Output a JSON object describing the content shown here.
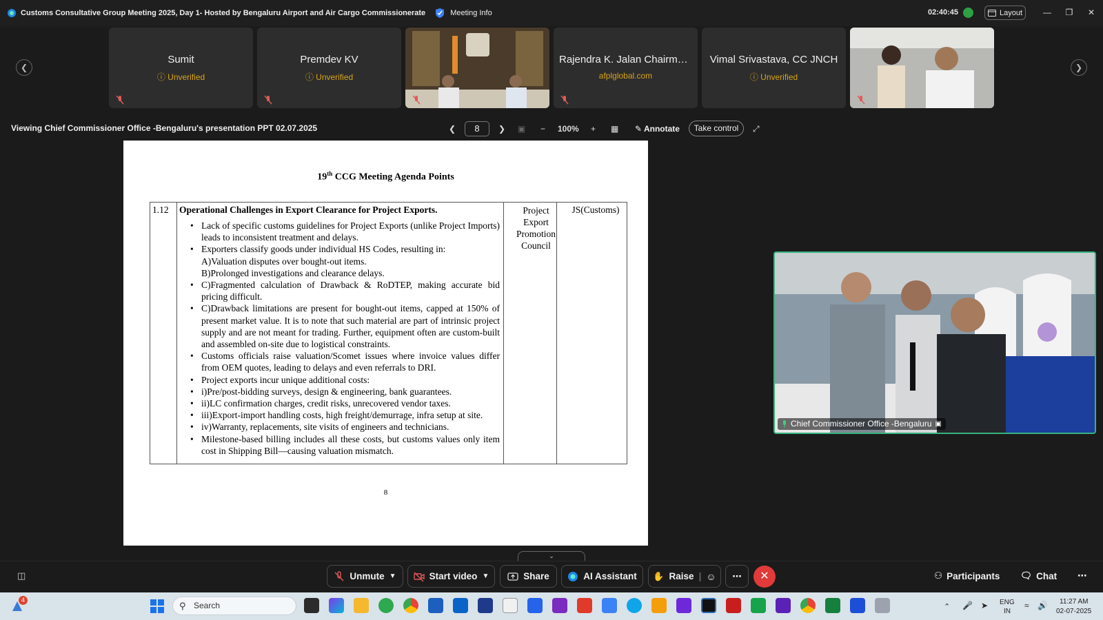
{
  "window": {
    "title": "Customs Consultative Group Meeting 2025, Day 1- Hosted by Bengaluru Airport and Air Cargo Commissionerate",
    "meeting_info": "Meeting Info",
    "clock": "02:40:45",
    "layout_label": "Layout"
  },
  "participants": [
    {
      "name": "Sumit",
      "status": "Unverified"
    },
    {
      "name": "Premdev KV",
      "status": "Unverified"
    },
    {
      "name": "",
      "status": ""
    },
    {
      "name": "Rajendra K. Jalan Chairman...",
      "status": "afplglobal.com"
    },
    {
      "name": "Vimal Srivastava, CC JNCH",
      "status": "Unverified"
    },
    {
      "name": "",
      "status": ""
    }
  ],
  "viewing": {
    "text": "Viewing Chief Commissioner Office -Bengaluru's presentation PPT 02.07.2025",
    "page": "8",
    "zoom": "100%",
    "annotate": "Annotate",
    "take_control": "Take control"
  },
  "slide": {
    "title_pre": "19",
    "title_sup": "th",
    "title_post": " CCG Meeting Agenda Points",
    "item_no": "1.12",
    "heading": "Operational Challenges in Export Clearance for Project Exports.",
    "bullets": [
      {
        "b": true,
        "t": "Lack of specific customs guidelines for Project Exports (unlike Project Imports) leads to inconsistent treatment and delays."
      },
      {
        "b": true,
        "t": "Exporters classify goods under individual HS Codes, resulting in:"
      },
      {
        "b": false,
        "t": "A)Valuation disputes over bought-out items."
      },
      {
        "b": false,
        "t": "B)Prolonged investigations and clearance delays."
      },
      {
        "b": true,
        "t": "C)Fragmented calculation of Drawback & RoDTEP, making accurate bid pricing difficult."
      },
      {
        "b": true,
        "t": "C)Drawback limitations are present for bought-out items, capped at 150% of present market value. It is to note that such material are part of intrinsic project supply and are not meant for trading. Further, equipment often are custom-built and assembled on-site due to logistical constraints."
      },
      {
        "b": true,
        "t": "Customs officials raise valuation/Scomet issues where invoice values differ from OEM quotes, leading to delays and even referrals to DRI."
      },
      {
        "b": true,
        "t": "Project exports incur unique additional costs:"
      },
      {
        "b": true,
        "t": "i)Pre/post-bidding surveys, design & engineering, bank guarantees."
      },
      {
        "b": true,
        "t": "ii)LC confirmation charges, credit risks, unrecovered vendor taxes."
      },
      {
        "b": true,
        "t": "iii)Export-import handling costs, high freight/demurrage, infra setup at site."
      },
      {
        "b": true,
        "t": "iv)Warranty, replacements, site visits of engineers and technicians."
      },
      {
        "b": true,
        "t": "Milestone-based billing includes all these costs, but customs values only item cost in Shipping Bill—causing valuation mismatch."
      }
    ],
    "col3": "Project Export Promotion Council",
    "col4": "JS(Customs)",
    "page_number": "8"
  },
  "speaker": {
    "name": "Chief Commissioner Office -Bengaluru"
  },
  "controls": {
    "unmute": "Unmute",
    "start_video": "Start video",
    "share": "Share",
    "ai_assistant": "AI Assistant",
    "raise": "Raise",
    "participants": "Participants",
    "chat": "Chat"
  },
  "taskbar": {
    "search": "Search",
    "lang1": "ENG",
    "lang2": "IN",
    "time": "11:27 AM",
    "date": "02-07-2025",
    "badge": "4"
  },
  "colors": {
    "accent_green": "#37b37e",
    "unverified": "#d9a419",
    "end_call": "#e03a3a"
  }
}
